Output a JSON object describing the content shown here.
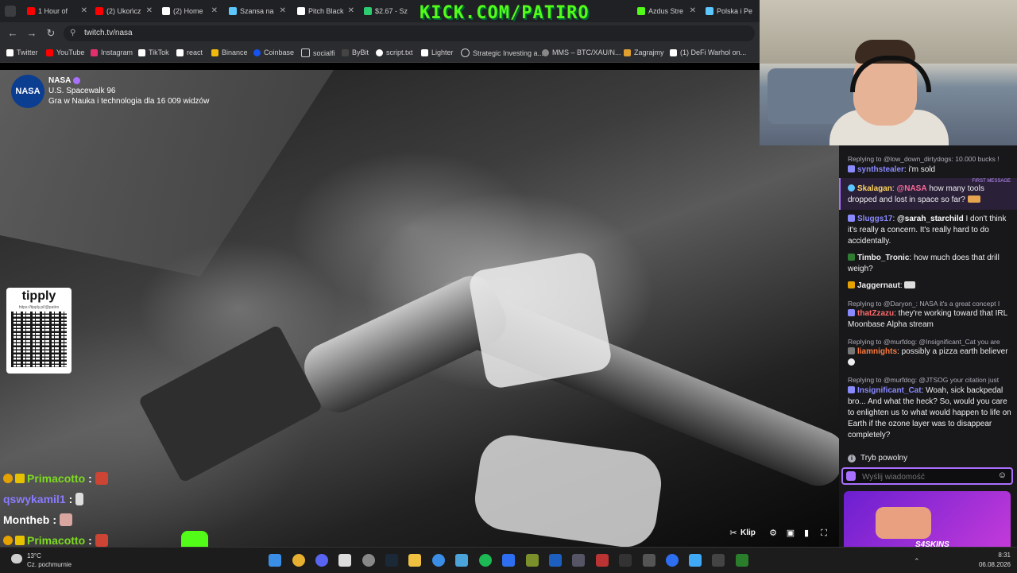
{
  "browser": {
    "tabs": [
      {
        "title": "1 Hour of",
        "color": "#ff0000"
      },
      {
        "title": "(2) Ukończ",
        "color": "#ff0000"
      },
      {
        "title": "(2) Home",
        "color": "#ffffff"
      },
      {
        "title": "Szansa na",
        "color": "#5cc8ff"
      },
      {
        "title": "Pitch Black",
        "color": "#ffffff"
      },
      {
        "title": "$2.67 - Sz",
        "color": "#2ecc71"
      },
      {
        "title": "",
        "color": "#53fc18"
      },
      {
        "title": "",
        "color": "#53fc18"
      },
      {
        "title": "Azdus Stre",
        "color": "#53fc18"
      },
      {
        "title": "Polska i Pe",
        "color": "#5cc8ff"
      }
    ],
    "url": "twitch.tv/nasa",
    "bookmarks": [
      {
        "label": "Twitter",
        "color": "#ffffff"
      },
      {
        "label": "YouTube",
        "color": "#ff0000"
      },
      {
        "label": "Instagram",
        "color": "#e1306c"
      },
      {
        "label": "TikTok",
        "color": "#ffffff"
      },
      {
        "label": "react",
        "color": "#ffffff"
      },
      {
        "label": "Binance",
        "color": "#f0b90b"
      },
      {
        "label": "Coinbase",
        "color": "#1652f0"
      },
      {
        "label": "socialfi",
        "color": "#cccccc"
      },
      {
        "label": "ByBit",
        "color": "#cccccc"
      },
      {
        "label": "script.txt",
        "color": "#ffffff"
      },
      {
        "label": "Lighter",
        "color": "#ffffff"
      },
      {
        "label": "Strategic Investing a...",
        "color": "#cccccc"
      },
      {
        "label": "MMS – BTC/XAU/N...",
        "color": "#cccccc"
      },
      {
        "label": "Zagrajmy",
        "color": "#e0a030"
      },
      {
        "label": "(1) DeFi Warhol on...",
        "color": "#ffffff"
      }
    ]
  },
  "kick_banner": "KICK.COM/PATIRO",
  "stream": {
    "channel": "NASA",
    "logo_text": "NASA",
    "title": "U.S. Spacewalk 96",
    "category_line": "Gra w Nauka i technologia dla 16 009 widzów"
  },
  "tipply": {
    "title": "tipply",
    "sub": "https://tipply.pl/@patiro"
  },
  "overlay_chat": [
    {
      "name": "Primacotto",
      "sep": ":",
      "color": "#7ddc1f"
    },
    {
      "name": "qswykamil1",
      "sep": ":",
      "color": "#8a7bff"
    },
    {
      "name": "Montheb",
      "sep": ":",
      "color": "#ffffff"
    },
    {
      "name": "Primacotto",
      "sep": ":",
      "color": "#7ddc1f"
    }
  ],
  "video_controls": {
    "clip_label": "Klip"
  },
  "chat": {
    "messages": [
      {
        "reply": "Replying to @low_down_dirtydogs: 10.000 bucks !",
        "user": "synthstealer",
        "color": "#8a8aff",
        "text": "i'm sold"
      },
      {
        "reply": "",
        "first_label": "FIRST MESSAGE",
        "user": "Skalagan",
        "color": "#ffd45c",
        "mention": "@NASA",
        "text": "how many tools dropped and lost in space so far?"
      },
      {
        "reply": "",
        "user": "Sluggs17",
        "color": "#8a8aff",
        "mention": "@sarah_starchild",
        "text": "I don't think it's really a concern. It's really hard to do accidentally."
      },
      {
        "reply": "",
        "user": "Timbo_Tronic",
        "color": "#ffffff",
        "text": "how much does that drill weigh?"
      },
      {
        "reply": "",
        "user": "Jaggernaut",
        "color": "#ffffff",
        "text": ""
      },
      {
        "reply": "Replying to @Daryon_: NASA it's a great concept I",
        "user": "thatZzazu",
        "color": "#ff6b6b",
        "text": "they're working toward that IRL Moonbase Alpha stream"
      },
      {
        "reply": "Replying to @murfdog: @Insignificant_Cat you are",
        "user": "liamnights",
        "color": "#ff7a3d",
        "text": "possibly a pizza earth believer"
      },
      {
        "reply": "Replying to @murfdog: @JTSOG your citation just",
        "user": "Insignificant_Cat",
        "color": "#8a8aff",
        "text": "Woah, sick backpedal bro... And what the heck? So, would you care to enlighten us to what would happen to life on Earth if the ozone layer was to disappear completely?"
      }
    ],
    "slow_mode": "Tryb powolny",
    "input_placeholder": "Wyślij wiadomość"
  },
  "skins_ad": {
    "text": "S4SKINS"
  },
  "taskbar": {
    "weather_temp": "13°C",
    "weather_desc": "Cz. pochmurnie",
    "time": "8:31",
    "date": "06.08.2026"
  }
}
